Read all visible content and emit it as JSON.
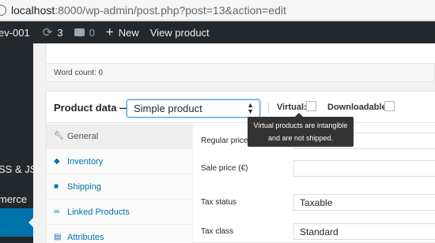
{
  "browser": {
    "url_host": "localhost",
    "url_rest": ":8000/wp-admin/post.php?post=13&action=edit"
  },
  "adminbar": {
    "site_name": "ev-001",
    "updates_count": "3",
    "comments_count": "0",
    "new_label": "New",
    "view_label": "View product"
  },
  "sidebar": {
    "items": [
      "SS & JS",
      "merce"
    ]
  },
  "editor": {
    "word_count": "Word count: 0"
  },
  "product_data": {
    "title": "Product data —",
    "type_selected": "Simple product",
    "virtual_label": "Virtual:",
    "downloadable_label": "Downloadable:",
    "tooltip_line1": "Virtual products are intangible",
    "tooltip_line2": "and are not shipped.",
    "tabs": [
      {
        "label": "General",
        "icon": "wrench-icon"
      },
      {
        "label": "Inventory",
        "icon": "tag-icon"
      },
      {
        "label": "Shipping",
        "icon": "truck-icon"
      },
      {
        "label": "Linked Products",
        "icon": "link-icon"
      },
      {
        "label": "Attributes",
        "icon": "list-icon"
      }
    ],
    "fields": {
      "regular_price_label": "Regular price",
      "sale_price_label": "Sale price (€)",
      "tax_status_label": "Tax status",
      "tax_status_value": "Taxable",
      "tax_class_label": "Tax class",
      "tax_class_value": "Standard"
    }
  },
  "colors": {
    "admin_dark": "#23282d",
    "accent_blue": "#0073aa"
  }
}
